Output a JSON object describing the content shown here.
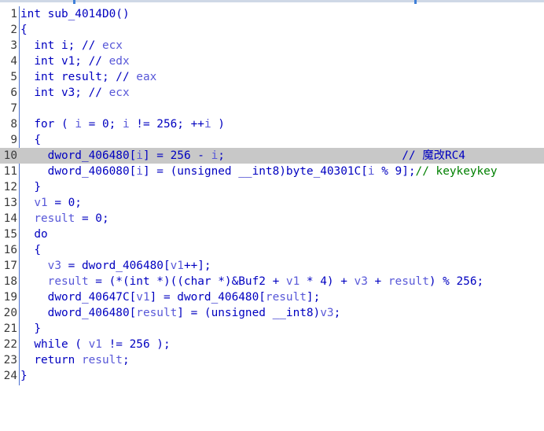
{
  "lines": [
    {
      "num": "1"
    },
    {
      "num": "2"
    },
    {
      "num": "3"
    },
    {
      "num": "4"
    },
    {
      "num": "5"
    },
    {
      "num": "6"
    },
    {
      "num": "7"
    },
    {
      "num": "8"
    },
    {
      "num": "9"
    },
    {
      "num": "10"
    },
    {
      "num": "11"
    },
    {
      "num": "12"
    },
    {
      "num": "13"
    },
    {
      "num": "14"
    },
    {
      "num": "15"
    },
    {
      "num": "16"
    },
    {
      "num": "17"
    },
    {
      "num": "18"
    },
    {
      "num": "19"
    },
    {
      "num": "20"
    },
    {
      "num": "21"
    },
    {
      "num": "22"
    },
    {
      "num": "23"
    },
    {
      "num": "24"
    }
  ],
  "code": {
    "l1": "int sub_4014D0()",
    "l2": "{",
    "l3a": "  int i; // ",
    "l3b": "ecx",
    "l4a": "  int v1; // ",
    "l4b": "edx",
    "l5a": "  int result; // ",
    "l5b": "eax",
    "l6a": "  int v3; // ",
    "l6b": "ecx",
    "l7": "",
    "l8a": "  for ( ",
    "l8b": "i",
    "l8c": " = 0; ",
    "l8d": "i",
    "l8e": " != 256; ++",
    "l8f": "i",
    "l8g": " )",
    "l9": "  {",
    "l10a": "    dword_406480[",
    "l10b": "i",
    "l10c": "] = 256 - ",
    "l10d": "i",
    "l10e": ";                          // 魔改RC4",
    "l11a": "    dword_406080[",
    "l11b": "i",
    "l11c": "] = (unsigned __int8)byte_40301C[",
    "l11d": "i",
    "l11e": " % 9];",
    "l11f": "// keykeykey",
    "l12": "  }",
    "l13a": "  ",
    "l13b": "v1",
    "l13c": " = 0;",
    "l14a": "  ",
    "l14b": "result",
    "l14c": " = 0;",
    "l15": "  do",
    "l16": "  {",
    "l17a": "    ",
    "l17b": "v3",
    "l17c": " = dword_406480[",
    "l17d": "v1",
    "l17e": "++];",
    "l18a": "    ",
    "l18b": "result",
    "l18c": " = (*(int *)((char *)&Buf2 + ",
    "l18d": "v1",
    "l18e": " * 4) + ",
    "l18f": "v3",
    "l18g": " + ",
    "l18h": "result",
    "l18i": ") % 256;",
    "l19a": "    dword_40647C[",
    "l19b": "v1",
    "l19c": "] = dword_406480[",
    "l19d": "result",
    "l19e": "];",
    "l20a": "    dword_406480[",
    "l20b": "result",
    "l20c": "] = (unsigned __int8)",
    "l20d": "v3",
    "l20e": ";",
    "l21": "  }",
    "l22a": "  while ( ",
    "l22b": "v1",
    "l22c": " != 256 );",
    "l23a": "  return ",
    "l23b": "result",
    "l23c": ";",
    "l24": "}"
  },
  "colors": {
    "keyword": "#0000c0",
    "variable": "#5858d8",
    "comment_green": "#008000",
    "highlight": "#c8c8c8",
    "gutter_rule": "#4a6fd0"
  }
}
